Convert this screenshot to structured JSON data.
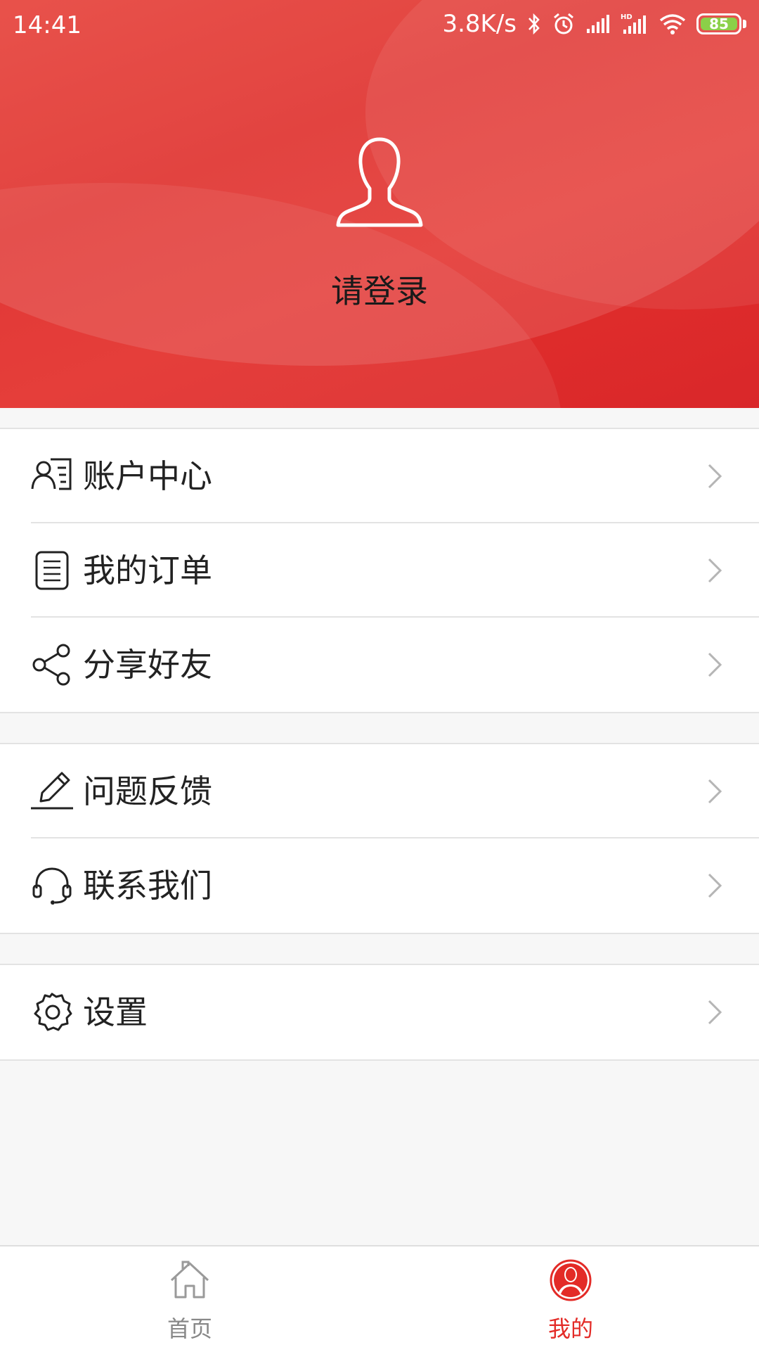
{
  "status_bar": {
    "time": "14:41",
    "net_speed": "3.8K/s",
    "battery": "85",
    "icons": [
      "bluetooth-icon",
      "alarm-icon",
      "signal-icon",
      "hd-signal-icon",
      "wifi-icon",
      "battery-icon"
    ]
  },
  "header": {
    "login_prompt": "请登录",
    "avatar_icon": "user-silhouette-icon"
  },
  "menu": {
    "group1": [
      {
        "label": "账户中心",
        "icon": "account-card-icon"
      },
      {
        "label": "我的订单",
        "icon": "order-list-icon"
      },
      {
        "label": "分享好友",
        "icon": "share-icon"
      }
    ],
    "group2": [
      {
        "label": "问题反馈",
        "icon": "pencil-icon"
      },
      {
        "label": "联系我们",
        "icon": "headset-icon"
      }
    ],
    "group3": [
      {
        "label": "设置",
        "icon": "gear-icon"
      }
    ]
  },
  "tabbar": {
    "home_label": "首页",
    "mine_label": "我的",
    "active_tab": "mine"
  },
  "colors": {
    "brand_red": "#e32b27",
    "tab_active": "#e32b27",
    "tab_inactive": "#888888",
    "battery_fill": "#8bd048"
  }
}
